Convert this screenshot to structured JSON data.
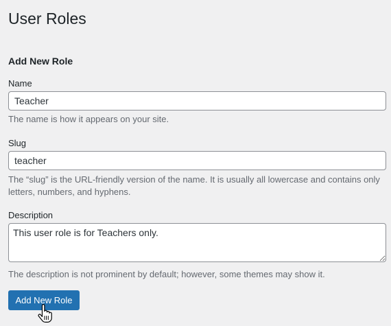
{
  "page": {
    "title": "User Roles"
  },
  "form": {
    "section_title": "Add New Role",
    "name": {
      "label": "Name",
      "value": "Teacher",
      "help": "The name is how it appears on your site."
    },
    "slug": {
      "label": "Slug",
      "value": "teacher",
      "help": "The “slug” is the URL-friendly version of the name. It is usually all lowercase and contains only letters, numbers, and hyphens."
    },
    "description": {
      "label": "Description",
      "value": "This user role is for Teachers only.",
      "help": "The description is not prominent by default; however, some themes may show it."
    },
    "submit_label": "Add New Role"
  },
  "colors": {
    "background": "#f0f0f1",
    "primary_button": "#2271b1",
    "help_text": "#646970",
    "input_border": "#8c8f94"
  },
  "icons": {
    "cursor": "hand-pointer-icon"
  }
}
